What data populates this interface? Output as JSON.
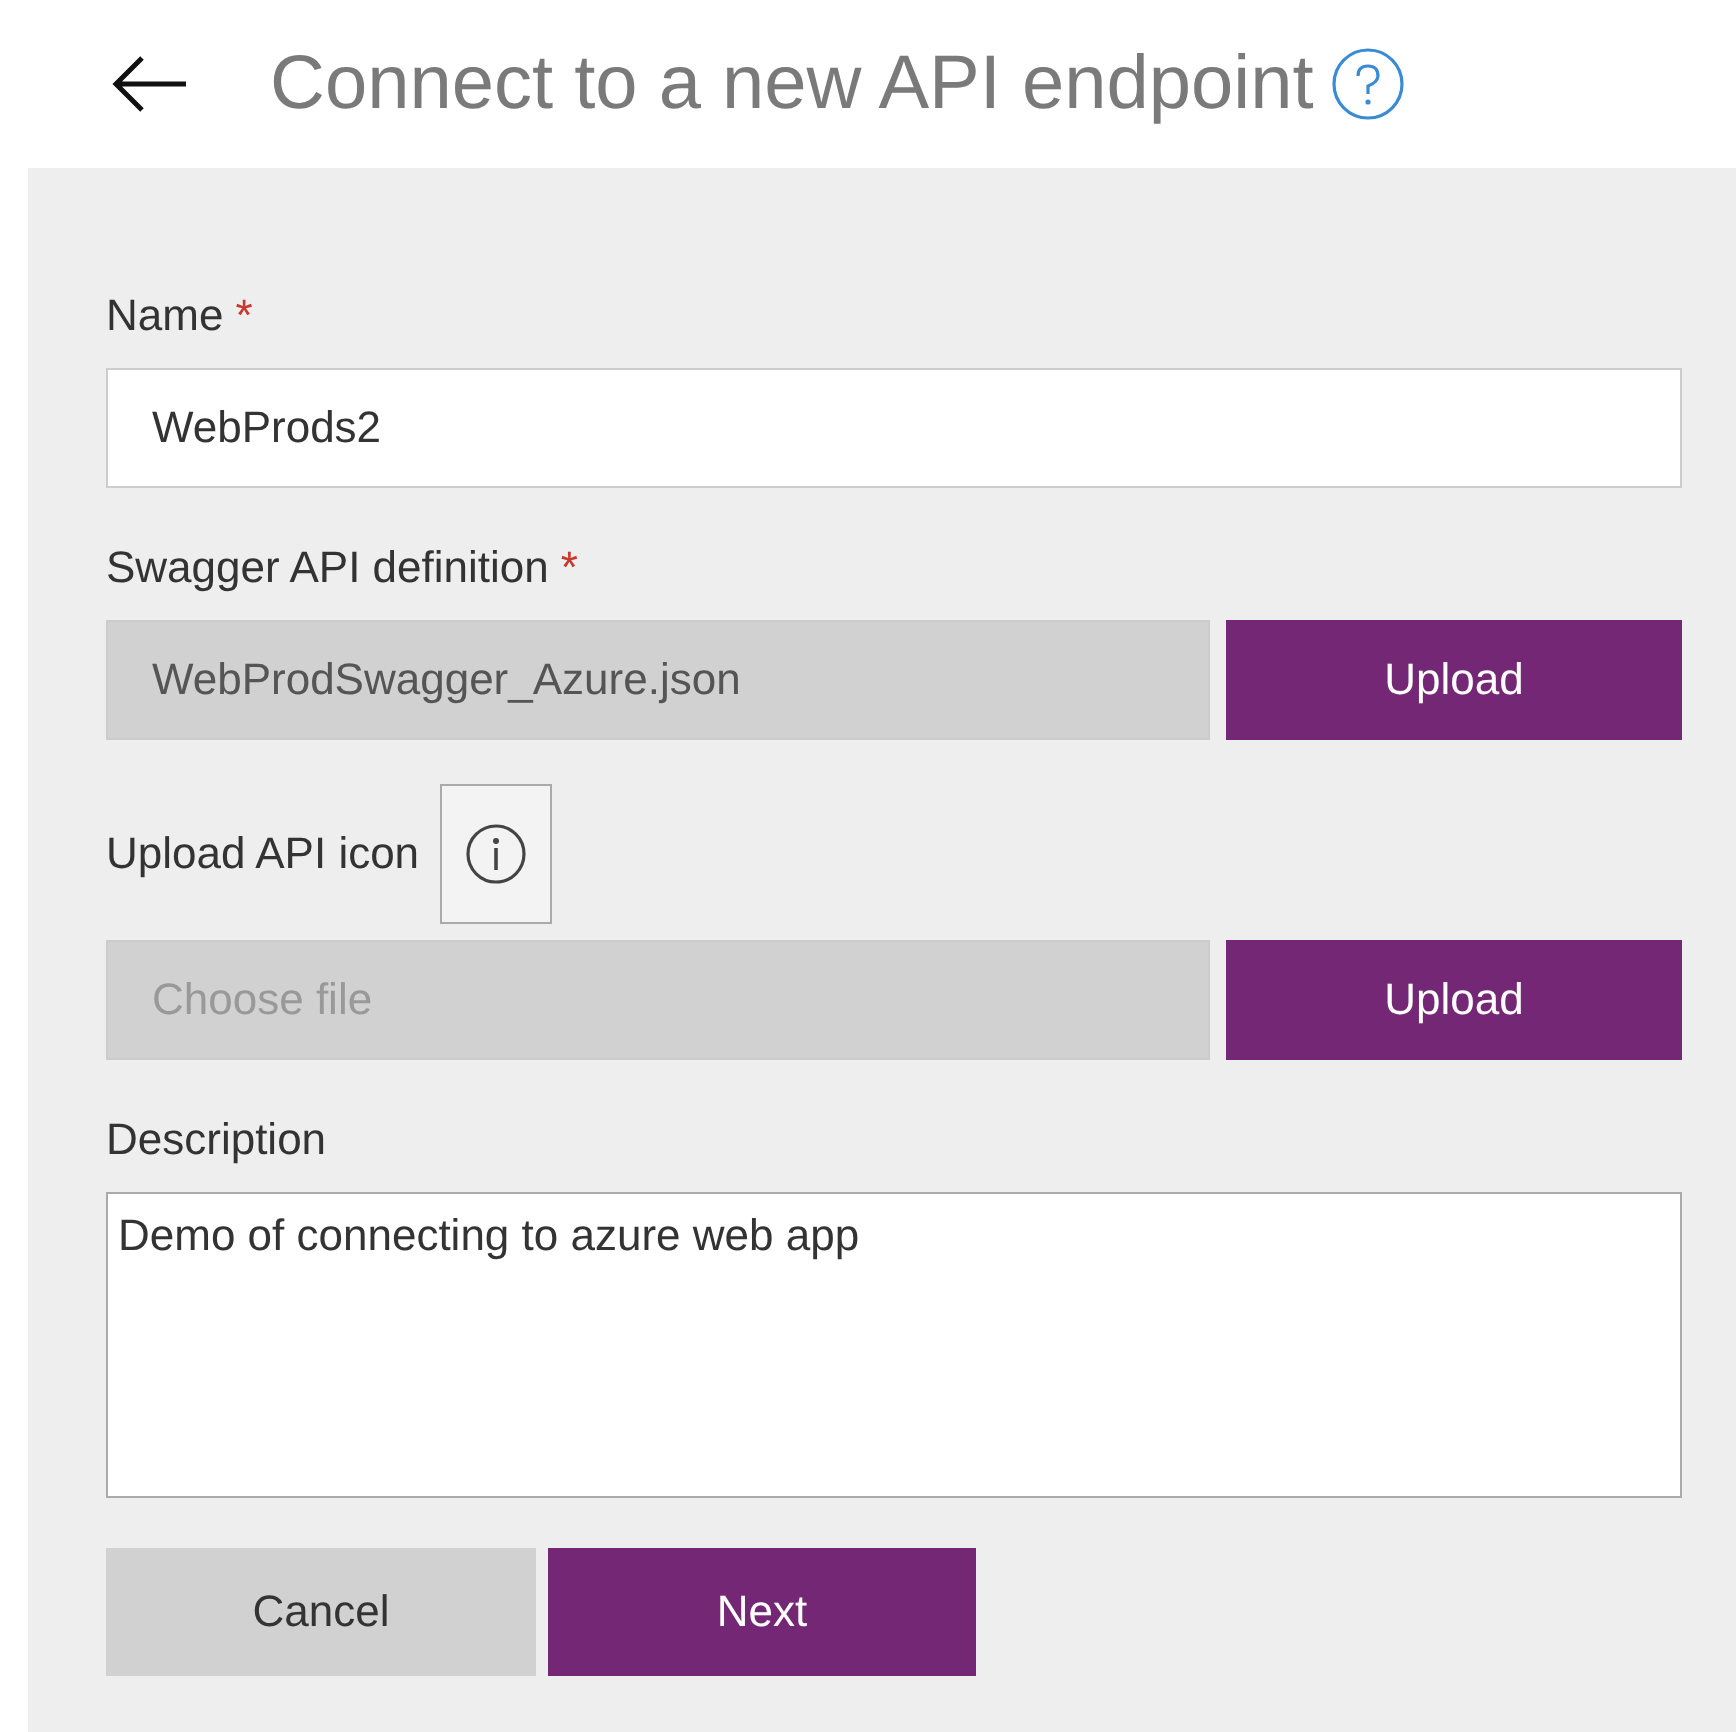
{
  "header": {
    "title": "Connect to a new API endpoint"
  },
  "form": {
    "name": {
      "label": "Name",
      "required_mark": "*",
      "value": "WebProds2"
    },
    "swagger": {
      "label": "Swagger API definition",
      "required_mark": "*",
      "value": "WebProdSwagger_Azure.json",
      "button": "Upload"
    },
    "icon": {
      "label": "Upload API icon",
      "placeholder": "Choose file",
      "button": "Upload"
    },
    "description": {
      "label": "Description",
      "value": "Demo of connecting to azure web app"
    }
  },
  "actions": [
    {
      "label": "Cancel",
      "kind": "secondary"
    },
    {
      "label": "Next",
      "kind": "primary"
    }
  ]
}
